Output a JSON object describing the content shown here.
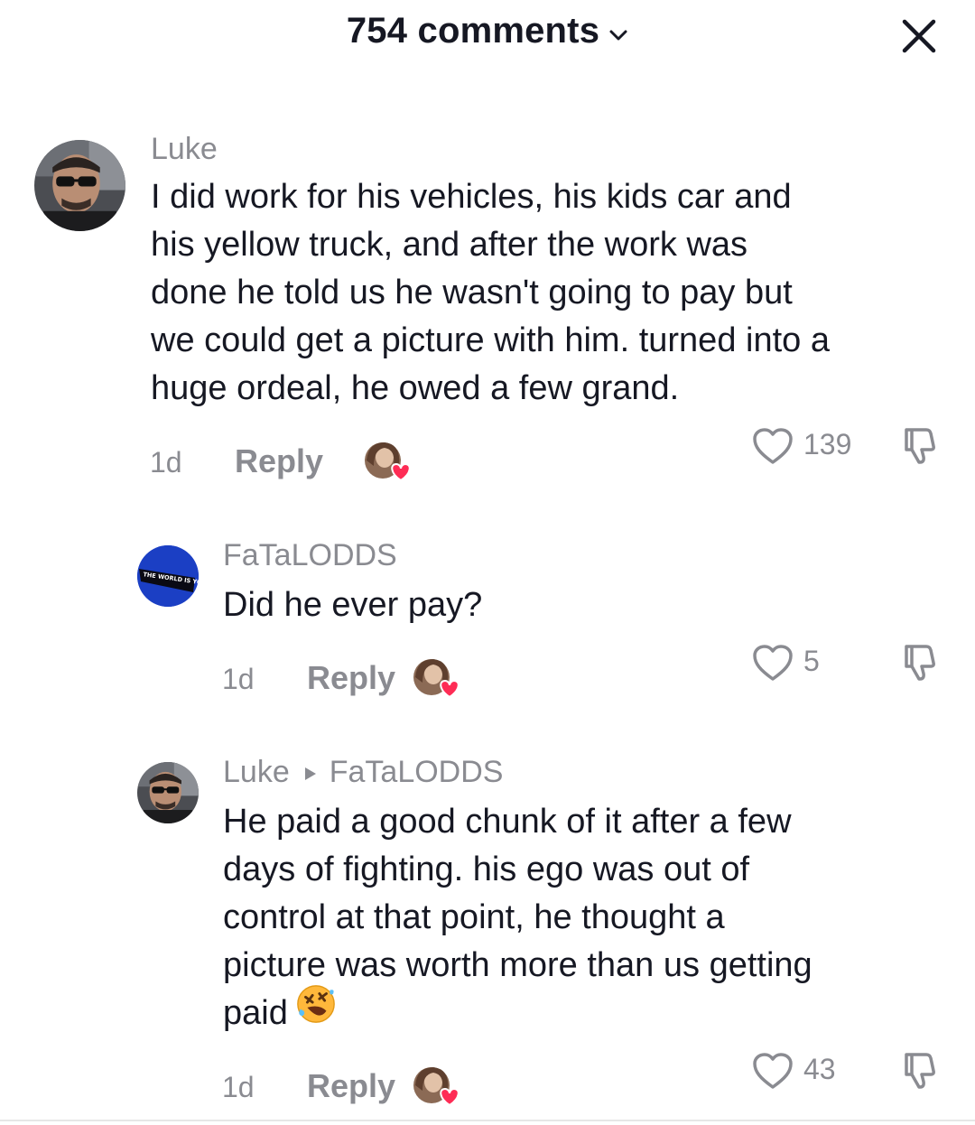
{
  "header": {
    "title": "754 comments"
  },
  "comments": [
    {
      "username": "Luke",
      "lines": [
        "I did work for his vehicles, his kids car and",
        "his yellow truck, and after the work was",
        "done he told us he wasn't going to pay but",
        "we could get a picture with him. turned into a",
        "huge ordeal, he owed a few grand."
      ],
      "time": "1d",
      "reply_label": "Reply",
      "likes": "139"
    },
    {
      "username": "FaTaLODDS",
      "avatar_text": "THE WORLD IS YOURS",
      "lines": [
        "Did he ever pay?"
      ],
      "time": "1d",
      "reply_label": "Reply",
      "likes": "5"
    },
    {
      "username": "Luke",
      "reply_to": "FaTaLODDS",
      "lines": [
        "He paid a good chunk of it after a few",
        "days of fighting. his ego was out of",
        "control at that point, he thought a",
        "picture was worth more than us getting",
        "paid"
      ],
      "time": "1d",
      "reply_label": "Reply",
      "likes": "43"
    }
  ],
  "colors": {
    "text": "#161823",
    "muted": "#8a8b91",
    "heart": "#fe2c55",
    "avatar_blue": "#1b3fc4"
  }
}
